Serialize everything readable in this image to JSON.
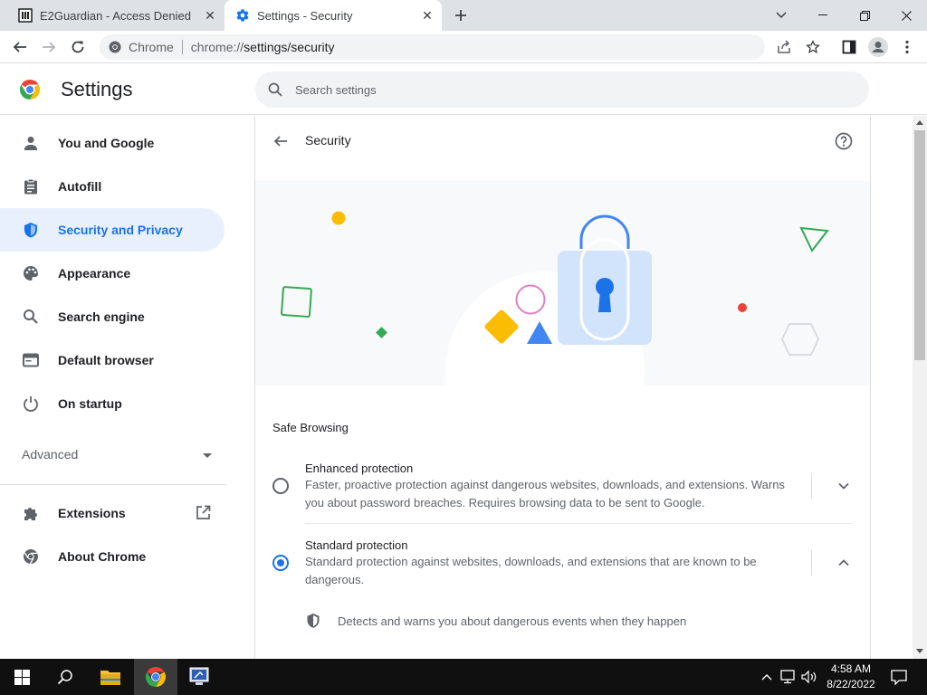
{
  "tabs": [
    {
      "title": "E2Guardian - Access Denied",
      "icon": "e2guardian-icon"
    },
    {
      "title": "Settings - Security",
      "icon": "gear-icon"
    }
  ],
  "toolbar": {
    "chip_label": "Chrome",
    "url_prefix": "chrome://",
    "url_path": "settings/security"
  },
  "header": {
    "title": "Settings",
    "search_placeholder": "Search settings"
  },
  "sidebar": {
    "items": [
      {
        "label": "You and Google",
        "icon": "person-icon"
      },
      {
        "label": "Autofill",
        "icon": "clipboard-icon"
      },
      {
        "label": "Security and Privacy",
        "icon": "shield-icon"
      },
      {
        "label": "Appearance",
        "icon": "palette-icon"
      },
      {
        "label": "Search engine",
        "icon": "search-icon"
      },
      {
        "label": "Default browser",
        "icon": "browser-icon"
      },
      {
        "label": "On startup",
        "icon": "power-icon"
      }
    ],
    "advanced_label": "Advanced",
    "bottom_items": [
      {
        "label": "Extensions",
        "icon": "puzzle-icon"
      },
      {
        "label": "About Chrome",
        "icon": "chrome-icon"
      }
    ]
  },
  "page": {
    "title": "Security",
    "section_heading": "Safe Browsing",
    "options": [
      {
        "title": "Enhanced protection",
        "description": "Faster, proactive protection against dangerous websites, downloads, and extensions. Warns you about password breaches. Requires browsing data to be sent to Google.",
        "selected": false
      },
      {
        "title": "Standard protection",
        "description": "Standard protection against websites, downloads, and extensions that are known to be dangerous.",
        "selected": true
      }
    ],
    "detail_text": "Detects and warns you about dangerous events when they happen"
  },
  "taskbar": {
    "time": "4:58 AM",
    "date": "8/22/2022"
  },
  "colors": {
    "accent": "#1a73e8",
    "active_nav_bg": "#e8f0fe",
    "tabstrip_bg": "#dee1e6",
    "taskbar_bg": "#101010"
  }
}
